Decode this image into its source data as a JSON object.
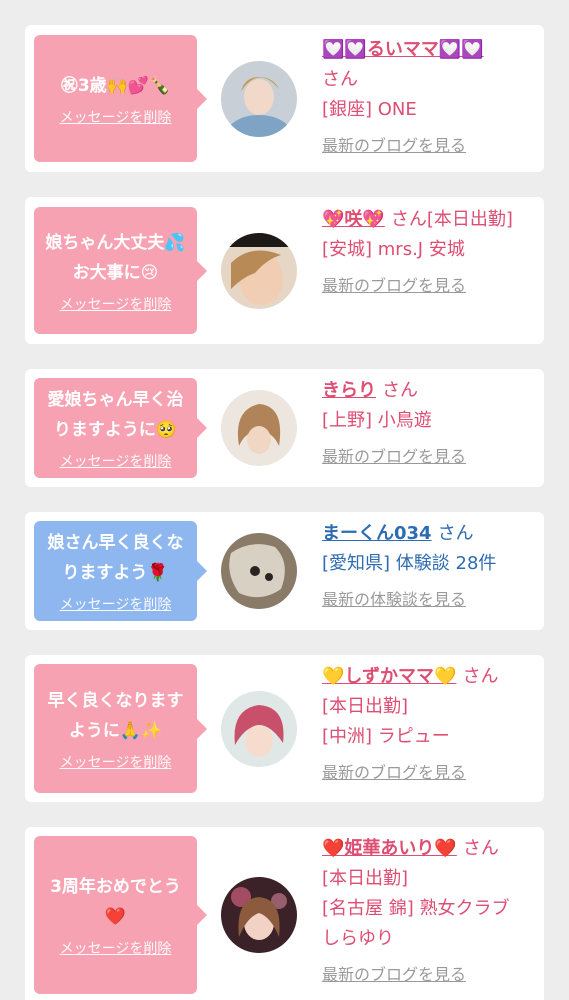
{
  "colors": {
    "pink_bubble": "#f7a2b2",
    "blue_bubble": "#8fb7ef",
    "pink_text": "#de4e73",
    "blue_text": "#2e6cb2",
    "link_gray": "#9a9a9a"
  },
  "cards": [
    {
      "bubble_color": "pink",
      "message_lines": [
        "㊗3歳🙌💕🍾"
      ],
      "delete_label": "メッセージを削除",
      "name": "💟💟るいママ💟💟",
      "honorific": "さん",
      "lines": [
        "[銀座] ONE"
      ],
      "link_label": "最新のブログを見る"
    },
    {
      "bubble_color": "pink",
      "message_lines": [
        "娘ちゃん大丈夫💦",
        "お大事に😢"
      ],
      "delete_label": "メッセージを削除",
      "name": "💖咲💖",
      "honorific": "さん[本日出勤]",
      "lines": [
        "[安城] mrs.J 安城"
      ],
      "link_label": "最新のブログを見る"
    },
    {
      "bubble_color": "pink",
      "message_lines": [
        "愛娘ちゃん早く治",
        "りますように🥺"
      ],
      "delete_label": "メッセージを削除",
      "name": "きらり",
      "honorific": "さん",
      "lines": [
        "[上野] 小鳥遊"
      ],
      "link_label": "最新のブログを見る"
    },
    {
      "bubble_color": "blue",
      "message_lines": [
        "娘さん早く良くな",
        "りますよう🌹"
      ],
      "delete_label": "メッセージを削除",
      "name": "まーくん034",
      "honorific": "さん",
      "lines": [
        "[愛知県] 体験談 28件"
      ],
      "link_label": "最新の体験談を見る"
    },
    {
      "bubble_color": "pink",
      "message_lines": [
        "早く良くなります",
        "ように🙏✨"
      ],
      "delete_label": "メッセージを削除",
      "name": "💛しずかママ💛",
      "honorific": "さん",
      "lines": [
        "[本日出勤]",
        "[中洲] ラピュー"
      ],
      "link_label": "最新のブログを見る"
    },
    {
      "bubble_color": "pink",
      "message_lines": [
        "3周年おめでとう",
        "❤️"
      ],
      "delete_label": "メッセージを削除",
      "name": "❤️姫華あいり❤️",
      "honorific": "さん",
      "lines": [
        "[本日出勤]",
        "[名古屋 錦] 熟女クラブ",
        "しらゆり"
      ],
      "link_label": "最新のブログを見る"
    }
  ]
}
